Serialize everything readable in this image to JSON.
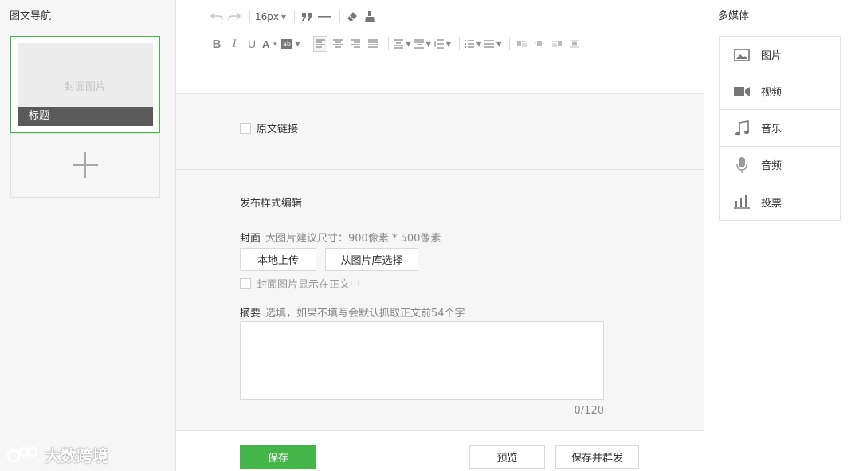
{
  "left": {
    "title": "图文导航",
    "cover_placeholder": "封面图片",
    "article_title": "标题"
  },
  "watermark": {
    "text": "大数跨境"
  },
  "toolbar": {
    "font_size": "16px"
  },
  "options": {
    "original_link_label": "原文链接"
  },
  "publish": {
    "section_title": "发布样式编辑",
    "cover_label": "封面",
    "cover_hint": "大图片建议尺寸：900像素 * 500像素",
    "upload_local_label": "本地上传",
    "choose_library_label": "从图片库选择",
    "show_cover_label": "封面图片显示在正文中",
    "summary_label": "摘要",
    "summary_hint": "选填，如果不填写会默认抓取正文前54个字",
    "summary_value": "",
    "summary_counter": "0/120"
  },
  "footer": {
    "save_label": "保存",
    "preview_label": "预览",
    "save_publish_label": "保存并群发"
  },
  "media": {
    "title": "多媒体",
    "items": [
      {
        "label": "图片",
        "icon": "image-icon"
      },
      {
        "label": "视频",
        "icon": "video-icon"
      },
      {
        "label": "音乐",
        "icon": "music-icon"
      },
      {
        "label": "音频",
        "icon": "microphone-icon"
      },
      {
        "label": "投票",
        "icon": "vote-chart-icon"
      }
    ]
  },
  "colors": {
    "accent": "#44b549",
    "icon_grey": "#9a9a9a"
  }
}
